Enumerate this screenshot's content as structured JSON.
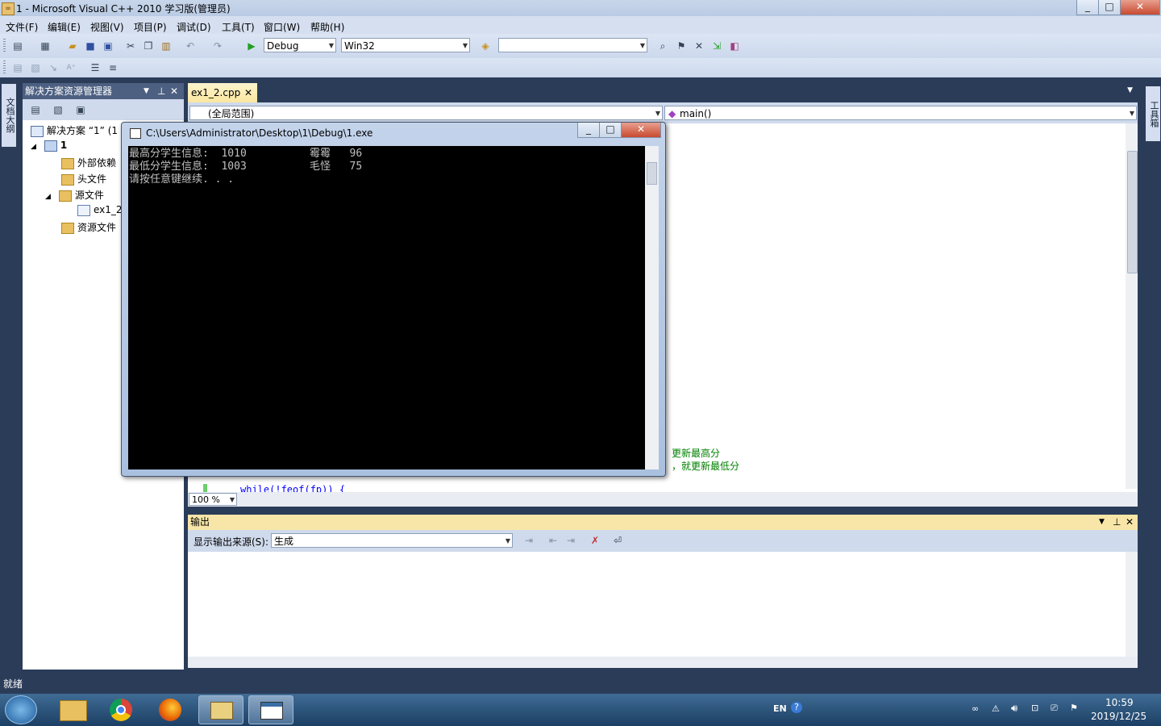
{
  "window": {
    "title": "1 - Microsoft Visual C++ 2010 学习版(管理员)",
    "minimize": "_",
    "maximize": "□",
    "close": "✕"
  },
  "menu": [
    "文件(F)",
    "编辑(E)",
    "视图(V)",
    "项目(P)",
    "调试(D)",
    "工具(T)",
    "窗口(W)",
    "帮助(H)"
  ],
  "toolbar": {
    "config": "Debug",
    "platform": "Win32",
    "find": ""
  },
  "left_tabs": [
    "文档大纲"
  ],
  "right_tabs": [
    "工具箱"
  ],
  "solution_explorer": {
    "title": "解决方案资源管理器",
    "items": [
      {
        "label": "解决方案 “1” (1",
        "level": 0
      },
      {
        "label": "1",
        "level": 1
      },
      {
        "label": "外部依赖",
        "level": 2
      },
      {
        "label": "头文件",
        "level": 2
      },
      {
        "label": "源文件",
        "level": 2
      },
      {
        "label": "ex1_2",
        "level": 3
      },
      {
        "label": "资源文件",
        "level": 2
      }
    ]
  },
  "editor": {
    "tab": "ex1_2.cpp",
    "scope": "(全局范围)",
    "member": "main()",
    "zoom": "100 %",
    "visible_code": [
      "更新最高分",
      "，就更新最低分",
      "while(!feof(fp)) {"
    ]
  },
  "console": {
    "title": "C:\\Users\\Administrator\\Desktop\\1\\Debug\\1.exe",
    "lines": [
      "最高分学生信息:  1010          霉霉   96",
      "最低分学生信息:  1003          毛怪   75",
      "请按任意键继续. . ."
    ]
  },
  "output": {
    "title": "输出",
    "source_label": "显示输出来源(S):",
    "source_value": "生成"
  },
  "status": {
    "text": "就绪"
  },
  "taskbar": {
    "lang": "EN",
    "time": "10:59",
    "date": "2019/12/25"
  }
}
